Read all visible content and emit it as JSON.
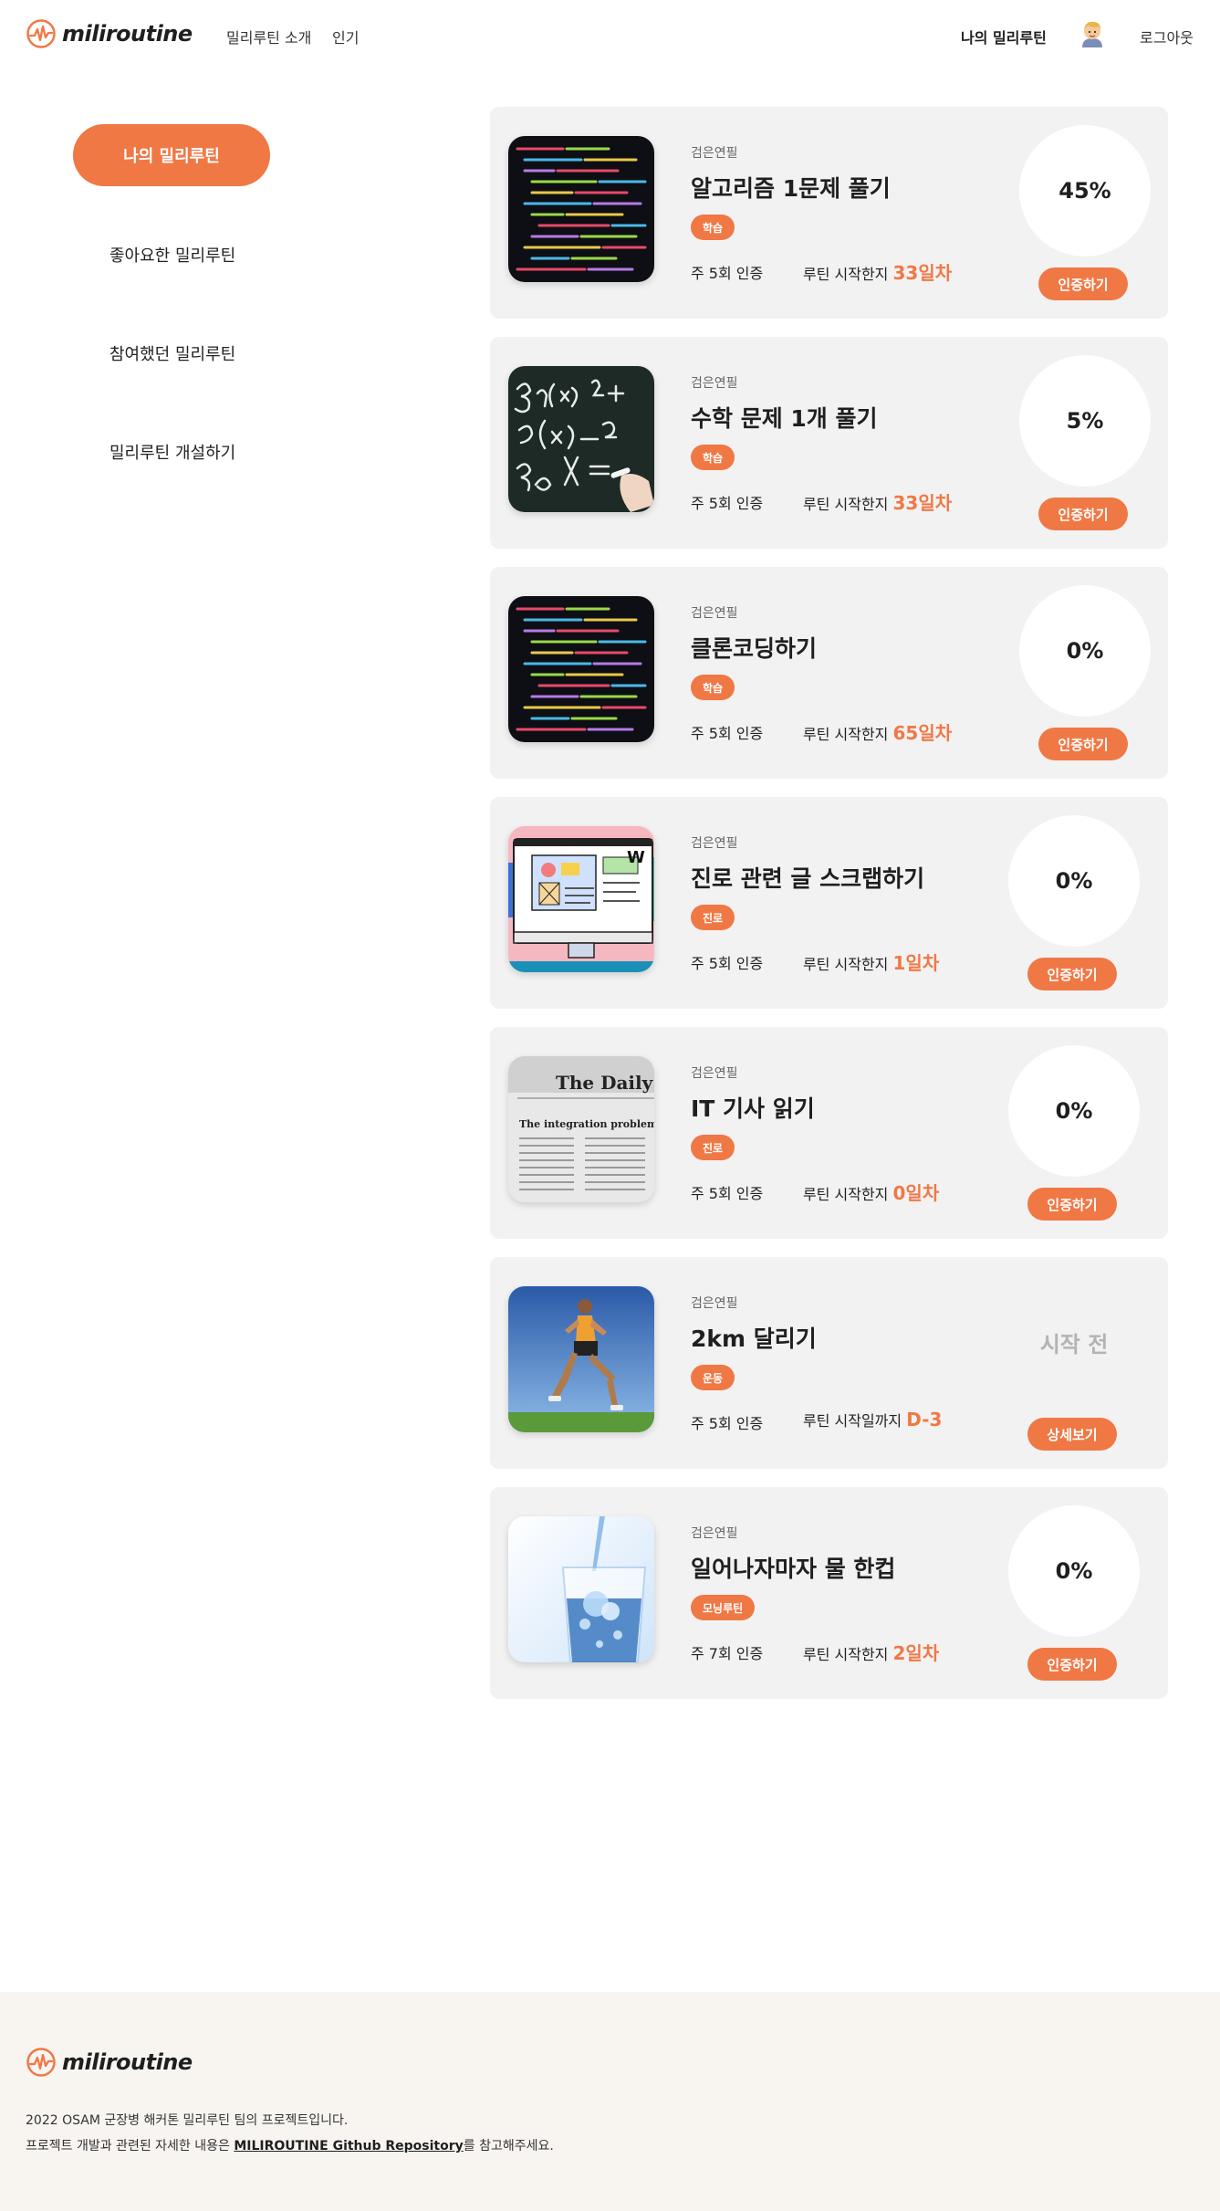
{
  "header": {
    "brand": "miliroutine",
    "nav": [
      "밀리루틴 소개",
      "인기"
    ],
    "my_routine": "나의 밀리루틴",
    "logout": "로그아웃"
  },
  "sidebar": {
    "items": [
      "나의 밀리루틴",
      "좋아요한 밀리루틴",
      "참여했던 밀리루틴",
      "밀리루틴 개설하기"
    ],
    "active_index": 0
  },
  "routines": [
    {
      "owner": "검은연필",
      "title": "알고리즘 1문제 풀기",
      "tag": "학습",
      "freq": "주 5회 인증",
      "since_label": "루틴 시작한지",
      "since_value": "33일차",
      "progress": "45%",
      "action": "인증하기",
      "image": "code-screen"
    },
    {
      "owner": "검은연필",
      "title": "수학 문제 1개 풀기",
      "tag": "학습",
      "freq": "주 5회 인증",
      "since_label": "루틴 시작한지",
      "since_value": "33일차",
      "progress": "5%",
      "action": "인증하기",
      "image": "chalkboard-math"
    },
    {
      "owner": "검은연필",
      "title": "클론코딩하기",
      "tag": "학습",
      "freq": "주 5회 인증",
      "since_label": "루틴 시작한지",
      "since_value": "65일차",
      "progress": "0%",
      "action": "인증하기",
      "image": "code-screen"
    },
    {
      "owner": "검은연필",
      "title": "진로 관련 글 스크랩하기",
      "tag": "진로",
      "freq": "주 5회 인증",
      "since_label": "루틴 시작한지",
      "since_value": "1일차",
      "progress": "0%",
      "action": "인증하기",
      "image": "web-illustration"
    },
    {
      "owner": "검은연필",
      "title": "IT 기사 읽기",
      "tag": "진로",
      "freq": "주 5회 인증",
      "since_label": "루틴 시작한지",
      "since_value": "0일차",
      "progress": "0%",
      "action": "인증하기",
      "image": "newspaper"
    },
    {
      "owner": "검은연필",
      "title": "2km 달리기",
      "tag": "운동",
      "freq": "주 5회 인증",
      "since_label": "루틴 시작일까지",
      "since_value": "D-3",
      "status": "시작 전",
      "action": "상세보기",
      "image": "runner"
    },
    {
      "owner": "검은연필",
      "title": "일어나자마자 물 한컵",
      "tag": "모닝루틴",
      "freq": "주 7회 인증",
      "since_label": "루틴 시작한지",
      "since_value": "2일차",
      "progress": "0%",
      "action": "인증하기",
      "image": "water-glass"
    }
  ],
  "newspaper_text": {
    "masthead": "The Daily",
    "headline": "The integration problem"
  },
  "footer": {
    "brand": "miliroutine",
    "line1": "2022 OSAM 군장병 해커톤 밀리루틴 팀의 프로젝트입니다.",
    "line2_prefix": "프로젝트 개발과 관련된 자세한 내용은 ",
    "line2_link": "MILIROUTINE Github Repository",
    "line2_suffix": "를 참고해주세요."
  },
  "colors": {
    "accent": "#f07845",
    "card_bg": "#f2f2f2",
    "footer_bg": "#f8f5f1"
  }
}
